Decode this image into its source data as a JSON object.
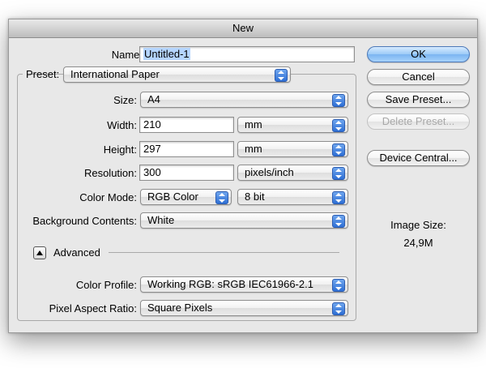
{
  "window": {
    "title": "New"
  },
  "name": {
    "label": "Name:",
    "value": "Untitled-1"
  },
  "preset": {
    "label": "Preset:",
    "value": "International Paper"
  },
  "size": {
    "label": "Size:",
    "value": "A4"
  },
  "width": {
    "label": "Width:",
    "value": "210",
    "unit": "mm"
  },
  "height": {
    "label": "Height:",
    "value": "297",
    "unit": "mm"
  },
  "resolution": {
    "label": "Resolution:",
    "value": "300",
    "unit": "pixels/inch"
  },
  "color_mode": {
    "label": "Color Mode:",
    "value": "RGB Color",
    "depth": "8 bit"
  },
  "background": {
    "label": "Background Contents:",
    "value": "White"
  },
  "advanced": {
    "label": "Advanced"
  },
  "color_profile": {
    "label": "Color Profile:",
    "value": "Working RGB:  sRGB IEC61966-2.1"
  },
  "pixel_aspect": {
    "label": "Pixel Aspect Ratio:",
    "value": "Square Pixels"
  },
  "buttons": {
    "ok": "OK",
    "cancel": "Cancel",
    "save_preset": "Save Preset...",
    "delete_preset": "Delete Preset...",
    "device_central": "Device Central..."
  },
  "image_size": {
    "label": "Image Size:",
    "value": "24,9M"
  },
  "colors": {
    "default_button": "#7bb5f1",
    "popup_arrows": "#2e6fd5",
    "selection": "#b5d5ff"
  }
}
